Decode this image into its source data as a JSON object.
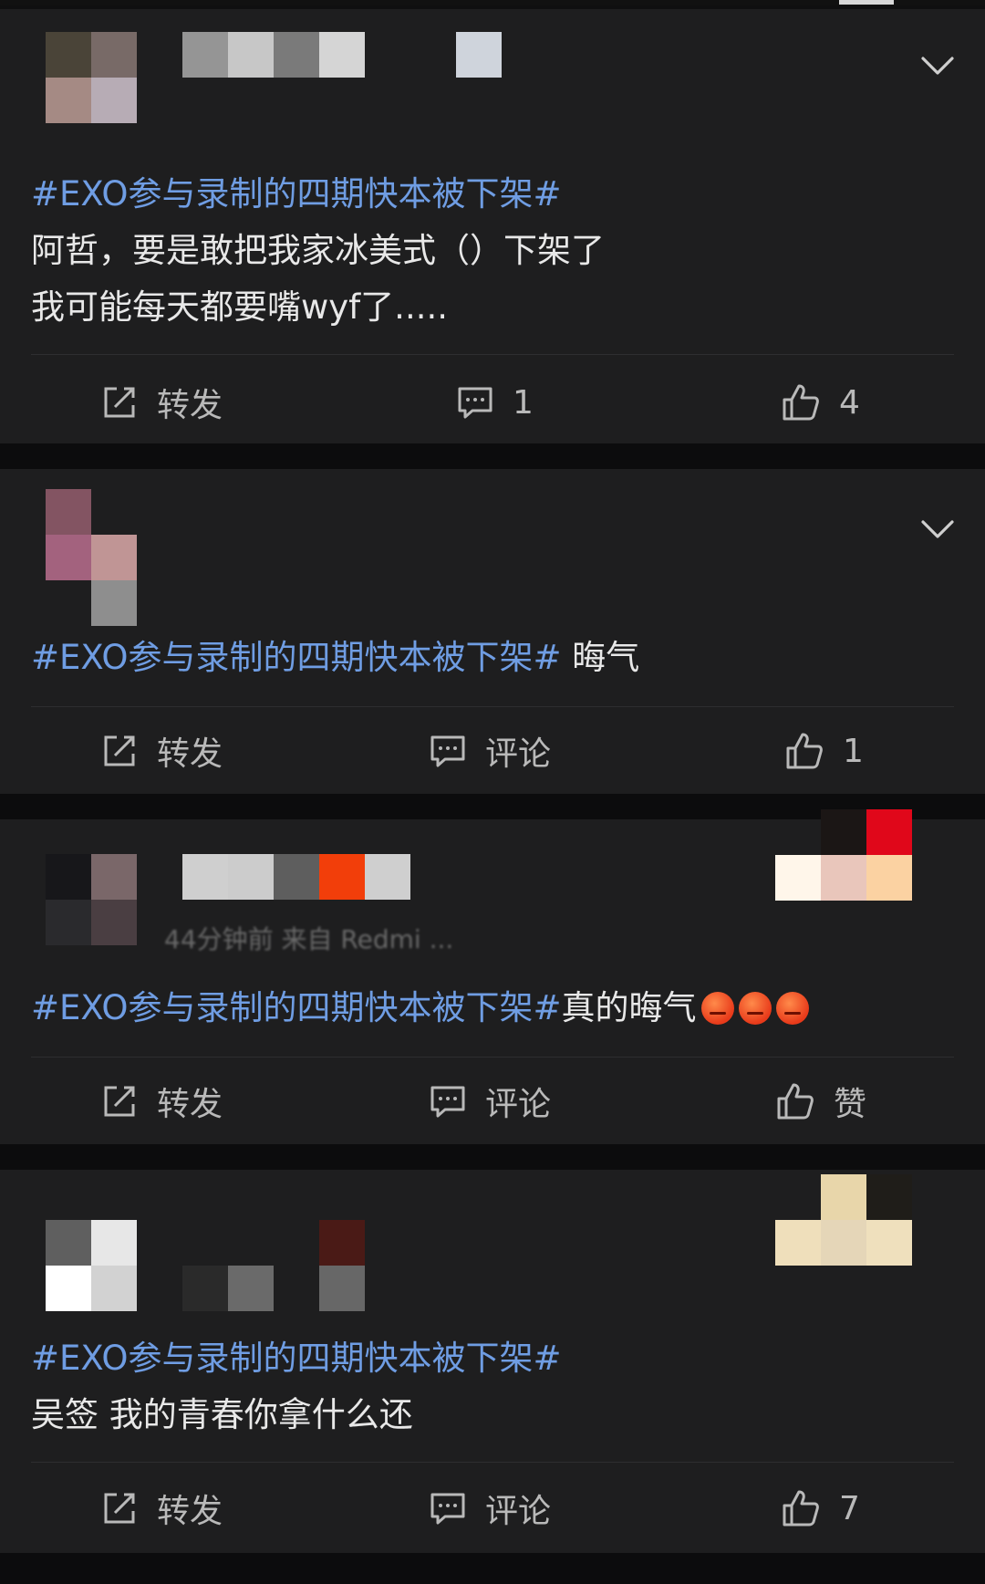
{
  "posts": [
    {
      "hashtag": "#EXO参与录制的四期快本被下架#",
      "body": "阿哲，要是敢把我家冰美式（）下架了\n我可能每天都要嘴wyf了.....",
      "actions": {
        "repost": "转发",
        "comment": "1",
        "like": "4"
      }
    },
    {
      "hashtag": "#EXO参与录制的四期快本被下架#",
      "body": " 晦气",
      "actions": {
        "repost": "转发",
        "comment": "评论",
        "like": "1"
      }
    },
    {
      "hashtag": "#EXO参与录制的四期快本被下架#",
      "body": "真的晦气",
      "meta": "44分钟前  来自 Redmi ...",
      "actions": {
        "repost": "转发",
        "comment": "评论",
        "like": "赞"
      }
    },
    {
      "hashtag": "#EXO参与录制的四期快本被下架#",
      "body": "吴签 我的青春你拿什么还",
      "actions": {
        "repost": "转发",
        "comment": "评论",
        "like": "7"
      }
    }
  ],
  "colors": {
    "background": "#0f0f10",
    "card": "#1e1e1f",
    "hashtag": "#6f9de3",
    "text": "#e8e8e8",
    "action": "#b9b9b9"
  },
  "icons": [
    "chevron-down-icon",
    "repost-icon",
    "comment-icon",
    "like-icon",
    "angry-face-emoji"
  ]
}
